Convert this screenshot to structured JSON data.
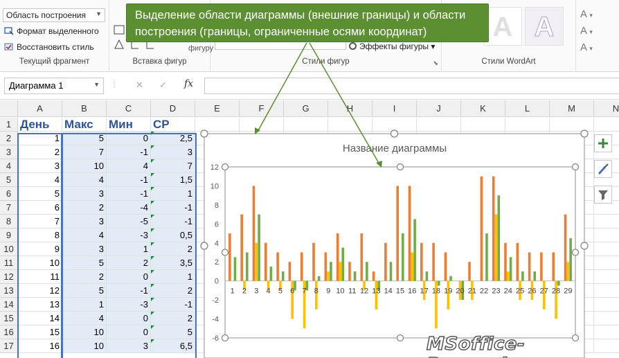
{
  "ribbon": {
    "selector_value": "Область построения",
    "format_selection": "Формат выделенного",
    "reset_style": "Восстановить стиль",
    "group_current": "Текущий фрагмент",
    "group_insert_shapes": "Вставка фигур",
    "group_shape_styles": "Стили фигур",
    "group_wordart": "Стили WordArt",
    "shape_label_partial": "фигуру",
    "shape_effects": "Эффекты фигуры",
    "wordart_sample": "A"
  },
  "callout": {
    "text": "Выделение области диаграммы (внешние границы) и области построения (границы, ограниченные осями координат)",
    "color": "#5b8f32"
  },
  "formula_bar": {
    "name_box": "Диаграмма 1",
    "cancel": "✕",
    "enter": "✓",
    "fx": "fx",
    "value": ""
  },
  "sheet": {
    "columns": [
      "A",
      "B",
      "C",
      "D",
      "E",
      "F",
      "G",
      "H",
      "I",
      "J",
      "K",
      "L",
      "M",
      "N"
    ],
    "headers": [
      "День",
      "Макс",
      "Мин",
      "СР"
    ],
    "rows": [
      {
        "n": "1"
      },
      {
        "n": "2",
        "a": "1",
        "b": "5",
        "c": "0",
        "d": "2,5"
      },
      {
        "n": "3",
        "a": "2",
        "b": "7",
        "c": "-1",
        "d": "3"
      },
      {
        "n": "4",
        "a": "3",
        "b": "10",
        "c": "4",
        "d": "7"
      },
      {
        "n": "5",
        "a": "4",
        "b": "4",
        "c": "-1",
        "d": "1,5"
      },
      {
        "n": "6",
        "a": "5",
        "b": "3",
        "c": "-1",
        "d": "1"
      },
      {
        "n": "7",
        "a": "6",
        "b": "2",
        "c": "-4",
        "d": "-1"
      },
      {
        "n": "8",
        "a": "7",
        "b": "3",
        "c": "-5",
        "d": "-1"
      },
      {
        "n": "9",
        "a": "8",
        "b": "4",
        "c": "-3",
        "d": "0,5"
      },
      {
        "n": "10",
        "a": "9",
        "b": "3",
        "c": "1",
        "d": "2"
      },
      {
        "n": "11",
        "a": "10",
        "b": "5",
        "c": "2",
        "d": "3,5"
      },
      {
        "n": "12",
        "a": "11",
        "b": "2",
        "c": "0",
        "d": "1"
      },
      {
        "n": "13",
        "a": "12",
        "b": "5",
        "c": "-1",
        "d": "2"
      },
      {
        "n": "14",
        "a": "13",
        "b": "1",
        "c": "-3",
        "d": "-1"
      },
      {
        "n": "15",
        "a": "14",
        "b": "4",
        "c": "0",
        "d": "2"
      },
      {
        "n": "16",
        "a": "15",
        "b": "10",
        "c": "0",
        "d": "5"
      },
      {
        "n": "17",
        "a": "16",
        "b": "10",
        "c": "3",
        "d": "6,5"
      }
    ]
  },
  "chart_data": {
    "type": "bar",
    "title": "Название диаграммы",
    "categories": [
      "1",
      "2",
      "3",
      "4",
      "5",
      "6",
      "7",
      "8",
      "9",
      "10",
      "11",
      "12",
      "13",
      "14",
      "15",
      "16",
      "17",
      "18",
      "19",
      "20",
      "21",
      "22",
      "23",
      "24",
      "25",
      "26",
      "27",
      "28",
      "29"
    ],
    "series": [
      {
        "color": "#ed7d31",
        "values": [
          5,
          7,
          10,
          4,
          3,
          2,
          3,
          4,
          3,
          5,
          2,
          5,
          1,
          4,
          10,
          10,
          4,
          4,
          3,
          0,
          2,
          11,
          11,
          4,
          4,
          3,
          3,
          3,
          7
        ]
      },
      {
        "color": "#ffc000",
        "values": [
          0,
          -1,
          4,
          -1,
          -1,
          -4,
          -5,
          -3,
          1,
          2,
          0,
          -1,
          -3,
          0,
          0,
          3,
          -2,
          -5,
          -3,
          -2,
          -2,
          0,
          7,
          1,
          -2,
          -2,
          -3,
          -4,
          2
        ]
      },
      {
        "color": "#70ad47",
        "values": [
          2.5,
          3,
          7,
          1.5,
          1,
          -1,
          -1,
          0.5,
          2,
          3.5,
          1,
          2,
          -1,
          2,
          5,
          6.5,
          1,
          -0.5,
          0.5,
          -2,
          0,
          5,
          9,
          2.5,
          1,
          1,
          0,
          -0.5,
          4.5
        ]
      }
    ],
    "ylim": [
      -6,
      12
    ],
    "yticks": [
      "12",
      "10",
      "8",
      "6",
      "4",
      "2",
      "0",
      "-2",
      "-4",
      "-6"
    ],
    "grid": false,
    "legend": "none"
  },
  "watermark": "MSoffice-Prowork.com",
  "icons": {
    "plus": "plus-icon",
    "brush": "brush-icon",
    "filter": "filter-icon"
  }
}
